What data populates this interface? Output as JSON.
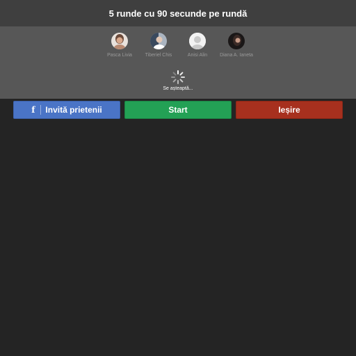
{
  "header": {
    "title": "5 runde cu 90 secunde pe rundă"
  },
  "players": [
    {
      "name": "Pasca Livia",
      "avatar_icon": "photo-avatar-woman",
      "color": "#b88a72"
    },
    {
      "name": "Tiberiel Chis",
      "avatar_icon": "photo-avatar-man",
      "color": "#6b7a8f"
    },
    {
      "name": "Anisi Alin",
      "avatar_icon": "default-avatar-silhouette",
      "color": "#d4d4d4"
    },
    {
      "name": "Diana A. Ianeta",
      "avatar_icon": "photo-avatar-dark",
      "color": "#2a2626"
    }
  ],
  "status": {
    "waiting_text": "Se așteaptă..."
  },
  "actions": {
    "invite_label": "Invită prietenii",
    "start_label": "Start",
    "exit_label": "Ieșire"
  },
  "colors": {
    "invite": "#4a74c6",
    "start": "#23a155",
    "exit": "#a7301e",
    "header_bg": "#3f3f3f",
    "lobby_bg": "#575757",
    "page_bg": "#242424"
  }
}
